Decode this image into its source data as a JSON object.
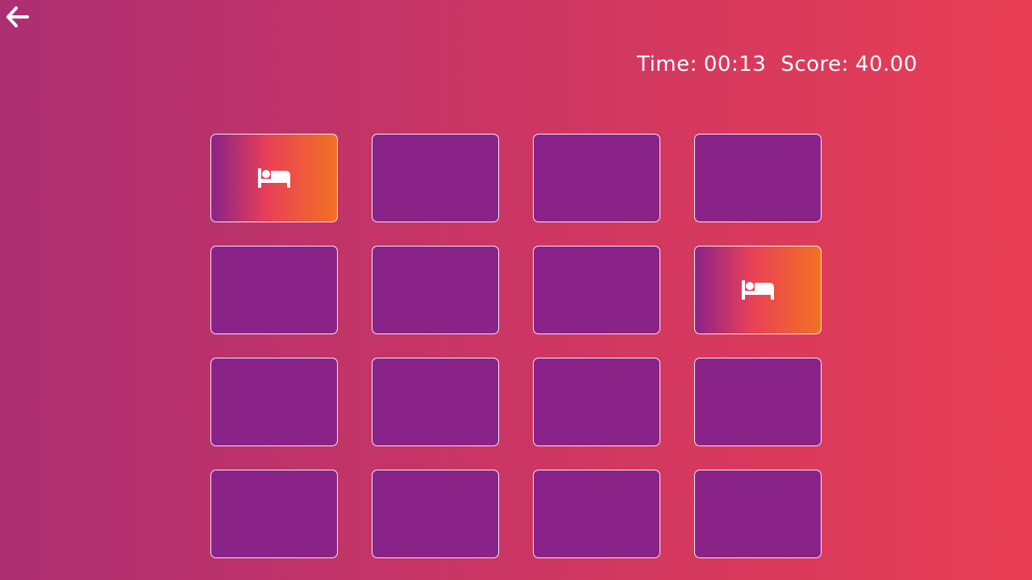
{
  "hud": {
    "time_label": "Time:",
    "time_value": "00:13",
    "score_label": "Score:",
    "score_value": "40.00"
  },
  "cards": [
    {
      "state": "flipped",
      "icon": "bed-icon"
    },
    {
      "state": "hidden"
    },
    {
      "state": "hidden"
    },
    {
      "state": "hidden"
    },
    {
      "state": "hidden"
    },
    {
      "state": "hidden"
    },
    {
      "state": "hidden"
    },
    {
      "state": "flipped",
      "icon": "bed-icon"
    },
    {
      "state": "hidden"
    },
    {
      "state": "hidden"
    },
    {
      "state": "hidden"
    },
    {
      "state": "hidden"
    },
    {
      "state": "hidden"
    },
    {
      "state": "hidden"
    },
    {
      "state": "hidden"
    },
    {
      "state": "hidden"
    }
  ],
  "colors": {
    "card_back": "#8a2387",
    "card_front_start": "#8a2387",
    "card_front_mid": "#e94057",
    "card_front_end": "#f27121"
  }
}
